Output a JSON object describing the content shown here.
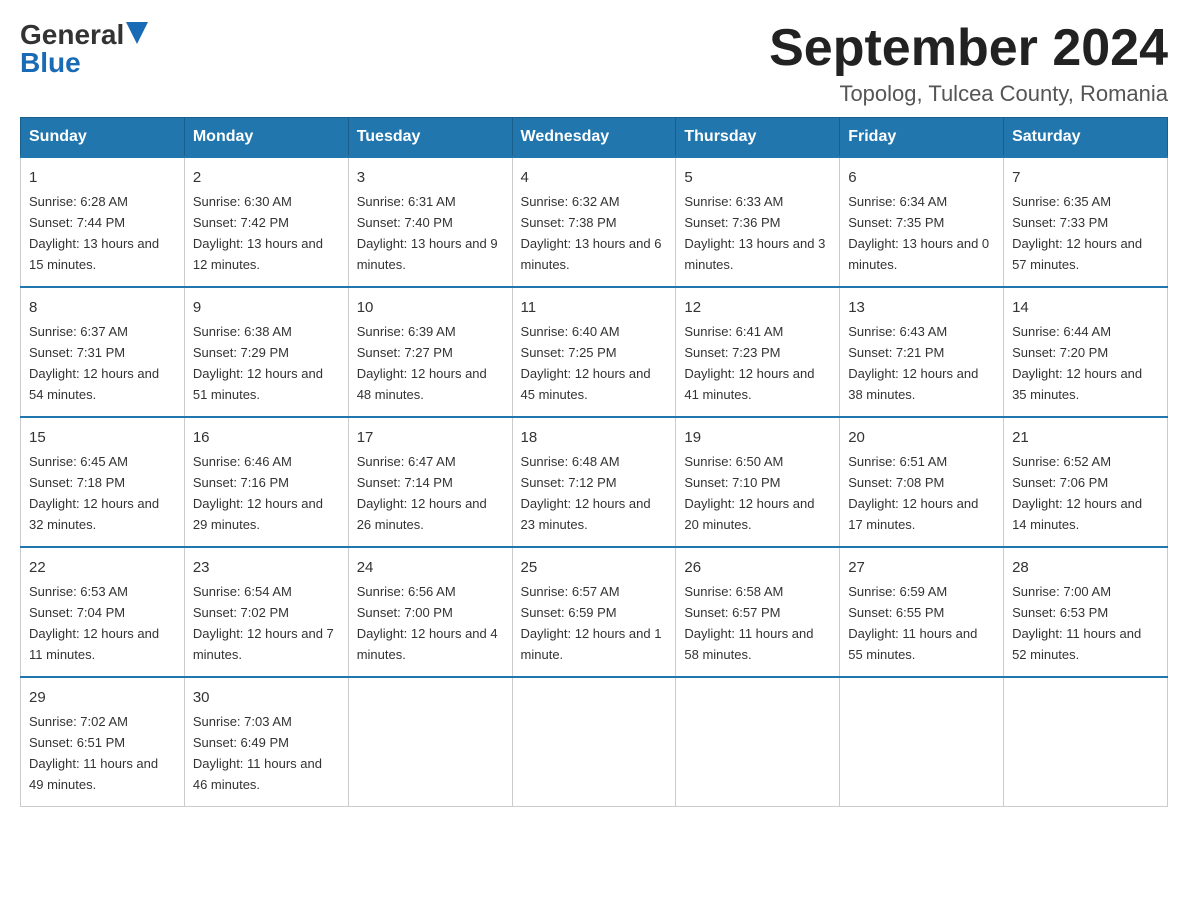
{
  "header": {
    "logo_general": "General",
    "logo_blue": "Blue",
    "month_title": "September 2024",
    "location": "Topolog, Tulcea County, Romania"
  },
  "weekdays": [
    "Sunday",
    "Monday",
    "Tuesday",
    "Wednesday",
    "Thursday",
    "Friday",
    "Saturday"
  ],
  "weeks": [
    [
      {
        "day": "1",
        "sunrise": "6:28 AM",
        "sunset": "7:44 PM",
        "daylight": "13 hours and 15 minutes."
      },
      {
        "day": "2",
        "sunrise": "6:30 AM",
        "sunset": "7:42 PM",
        "daylight": "13 hours and 12 minutes."
      },
      {
        "day": "3",
        "sunrise": "6:31 AM",
        "sunset": "7:40 PM",
        "daylight": "13 hours and 9 minutes."
      },
      {
        "day": "4",
        "sunrise": "6:32 AM",
        "sunset": "7:38 PM",
        "daylight": "13 hours and 6 minutes."
      },
      {
        "day": "5",
        "sunrise": "6:33 AM",
        "sunset": "7:36 PM",
        "daylight": "13 hours and 3 minutes."
      },
      {
        "day": "6",
        "sunrise": "6:34 AM",
        "sunset": "7:35 PM",
        "daylight": "13 hours and 0 minutes."
      },
      {
        "day": "7",
        "sunrise": "6:35 AM",
        "sunset": "7:33 PM",
        "daylight": "12 hours and 57 minutes."
      }
    ],
    [
      {
        "day": "8",
        "sunrise": "6:37 AM",
        "sunset": "7:31 PM",
        "daylight": "12 hours and 54 minutes."
      },
      {
        "day": "9",
        "sunrise": "6:38 AM",
        "sunset": "7:29 PM",
        "daylight": "12 hours and 51 minutes."
      },
      {
        "day": "10",
        "sunrise": "6:39 AM",
        "sunset": "7:27 PM",
        "daylight": "12 hours and 48 minutes."
      },
      {
        "day": "11",
        "sunrise": "6:40 AM",
        "sunset": "7:25 PM",
        "daylight": "12 hours and 45 minutes."
      },
      {
        "day": "12",
        "sunrise": "6:41 AM",
        "sunset": "7:23 PM",
        "daylight": "12 hours and 41 minutes."
      },
      {
        "day": "13",
        "sunrise": "6:43 AM",
        "sunset": "7:21 PM",
        "daylight": "12 hours and 38 minutes."
      },
      {
        "day": "14",
        "sunrise": "6:44 AM",
        "sunset": "7:20 PM",
        "daylight": "12 hours and 35 minutes."
      }
    ],
    [
      {
        "day": "15",
        "sunrise": "6:45 AM",
        "sunset": "7:18 PM",
        "daylight": "12 hours and 32 minutes."
      },
      {
        "day": "16",
        "sunrise": "6:46 AM",
        "sunset": "7:16 PM",
        "daylight": "12 hours and 29 minutes."
      },
      {
        "day": "17",
        "sunrise": "6:47 AM",
        "sunset": "7:14 PM",
        "daylight": "12 hours and 26 minutes."
      },
      {
        "day": "18",
        "sunrise": "6:48 AM",
        "sunset": "7:12 PM",
        "daylight": "12 hours and 23 minutes."
      },
      {
        "day": "19",
        "sunrise": "6:50 AM",
        "sunset": "7:10 PM",
        "daylight": "12 hours and 20 minutes."
      },
      {
        "day": "20",
        "sunrise": "6:51 AM",
        "sunset": "7:08 PM",
        "daylight": "12 hours and 17 minutes."
      },
      {
        "day": "21",
        "sunrise": "6:52 AM",
        "sunset": "7:06 PM",
        "daylight": "12 hours and 14 minutes."
      }
    ],
    [
      {
        "day": "22",
        "sunrise": "6:53 AM",
        "sunset": "7:04 PM",
        "daylight": "12 hours and 11 minutes."
      },
      {
        "day": "23",
        "sunrise": "6:54 AM",
        "sunset": "7:02 PM",
        "daylight": "12 hours and 7 minutes."
      },
      {
        "day": "24",
        "sunrise": "6:56 AM",
        "sunset": "7:00 PM",
        "daylight": "12 hours and 4 minutes."
      },
      {
        "day": "25",
        "sunrise": "6:57 AM",
        "sunset": "6:59 PM",
        "daylight": "12 hours and 1 minute."
      },
      {
        "day": "26",
        "sunrise": "6:58 AM",
        "sunset": "6:57 PM",
        "daylight": "11 hours and 58 minutes."
      },
      {
        "day": "27",
        "sunrise": "6:59 AM",
        "sunset": "6:55 PM",
        "daylight": "11 hours and 55 minutes."
      },
      {
        "day": "28",
        "sunrise": "7:00 AM",
        "sunset": "6:53 PM",
        "daylight": "11 hours and 52 minutes."
      }
    ],
    [
      {
        "day": "29",
        "sunrise": "7:02 AM",
        "sunset": "6:51 PM",
        "daylight": "11 hours and 49 minutes."
      },
      {
        "day": "30",
        "sunrise": "7:03 AM",
        "sunset": "6:49 PM",
        "daylight": "11 hours and 46 minutes."
      },
      null,
      null,
      null,
      null,
      null
    ]
  ]
}
